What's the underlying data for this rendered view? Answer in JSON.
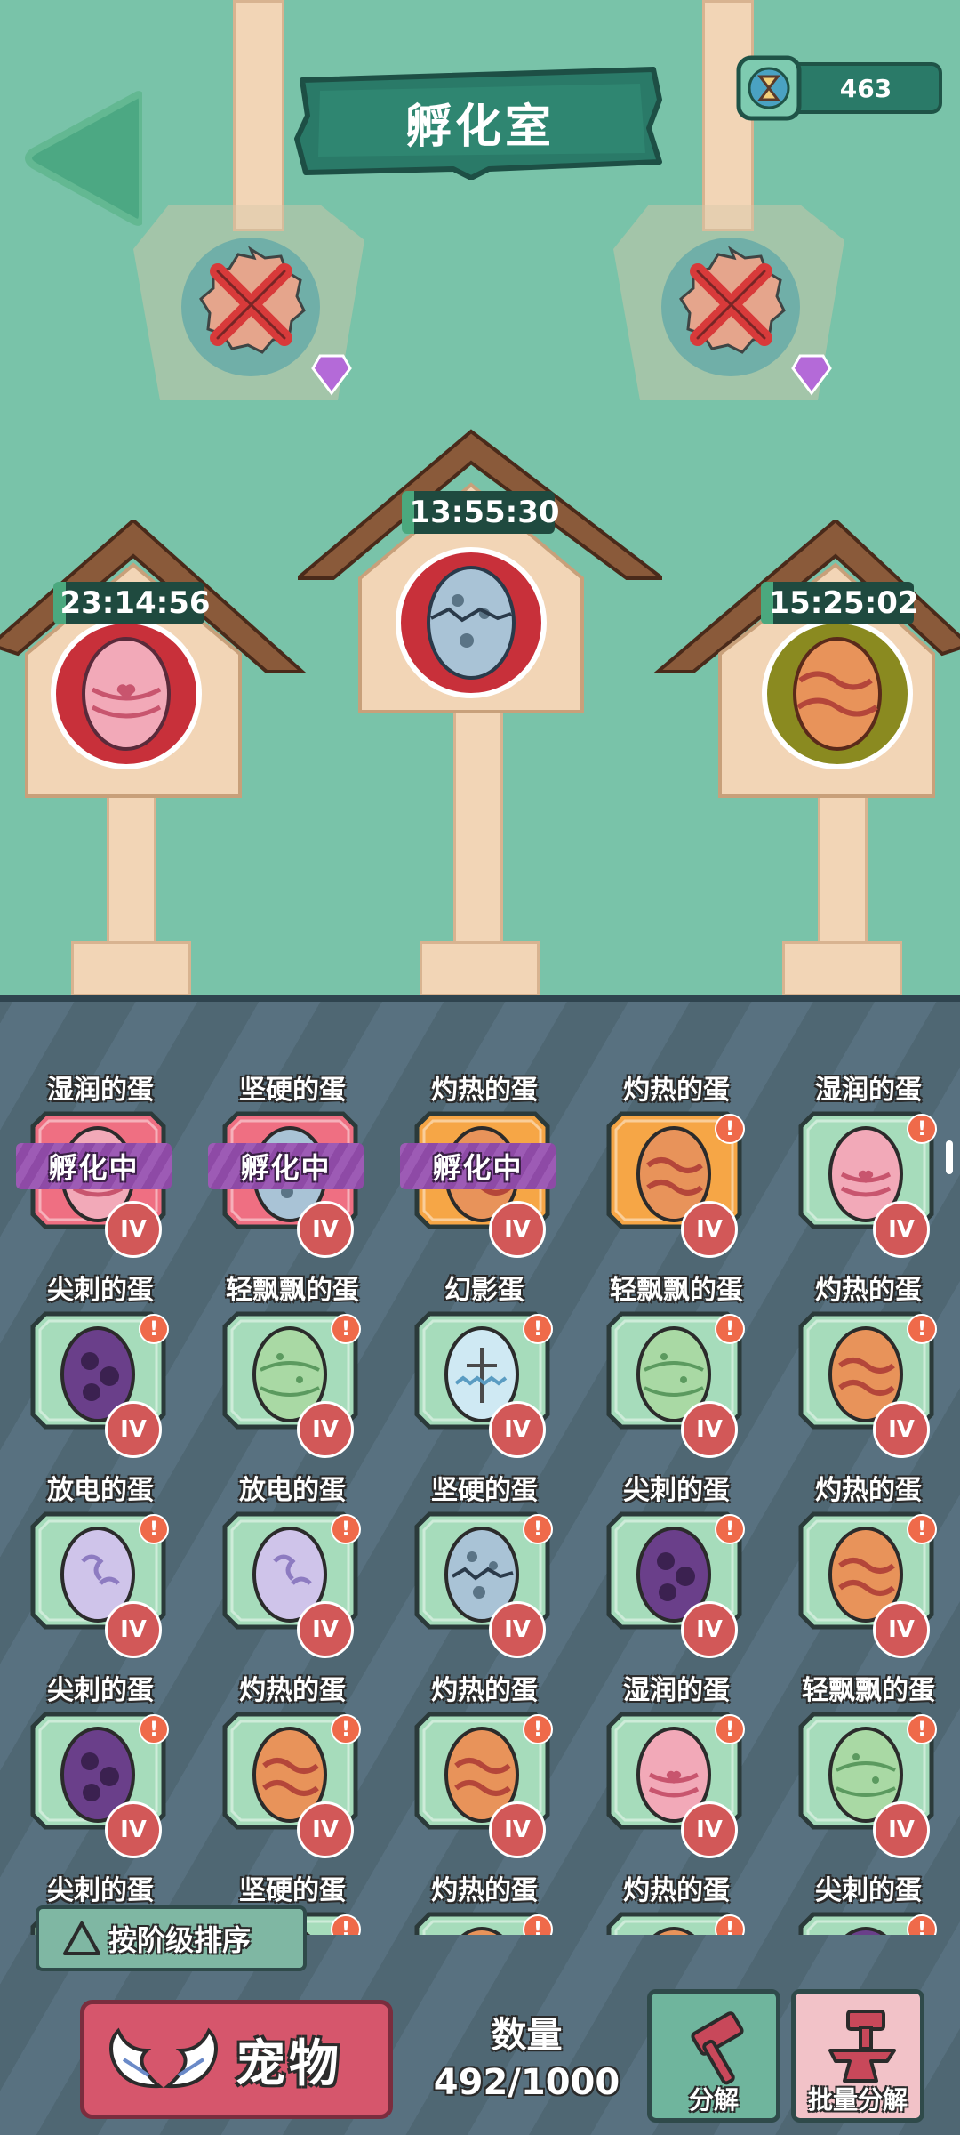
{
  "header": {
    "title": "孵化室"
  },
  "currency": {
    "value": "463",
    "icon": "hourglass-icon"
  },
  "incubators": [
    {
      "timer": "23:14:56",
      "egg": "湿润的蛋"
    },
    {
      "timer": "13:55:30",
      "egg": "坚硬的蛋"
    },
    {
      "timer": "15:25:02",
      "egg": "灼热的蛋"
    }
  ],
  "locked_slots": [
    {
      "icon": "repair-tools-icon",
      "badge": "gem-icon"
    },
    {
      "icon": "repair-tools-icon",
      "badge": "gem-icon"
    }
  ],
  "eggs": [
    {
      "name": "湿润的蛋",
      "kind": "moist",
      "status": "孵化中",
      "tier": "IV",
      "card": "red"
    },
    {
      "name": "坚硬的蛋",
      "kind": "hard",
      "status": "孵化中",
      "tier": "IV",
      "card": "red"
    },
    {
      "name": "灼热的蛋",
      "kind": "hot",
      "status": "孵化中",
      "tier": "IV",
      "card": "orange"
    },
    {
      "name": "灼热的蛋",
      "kind": "hot",
      "status": "",
      "tier": "IV",
      "card": "orange",
      "alert": "!"
    },
    {
      "name": "湿润的蛋",
      "kind": "moist",
      "status": "",
      "tier": "IV",
      "card": "green",
      "alert": "!"
    },
    {
      "name": "尖刺的蛋",
      "kind": "spike",
      "status": "",
      "tier": "IV",
      "card": "green",
      "alert": "!"
    },
    {
      "name": "轻飘飘的蛋",
      "kind": "light",
      "status": "",
      "tier": "IV",
      "card": "green",
      "alert": "!"
    },
    {
      "name": "幻影蛋",
      "kind": "phantom",
      "status": "",
      "tier": "IV",
      "card": "green",
      "alert": "!"
    },
    {
      "name": "轻飘飘的蛋",
      "kind": "light",
      "status": "",
      "tier": "IV",
      "card": "green",
      "alert": "!"
    },
    {
      "name": "灼热的蛋",
      "kind": "hot",
      "status": "",
      "tier": "IV",
      "card": "green",
      "alert": "!"
    },
    {
      "name": "放电的蛋",
      "kind": "electric",
      "status": "",
      "tier": "IV",
      "card": "green",
      "alert": "!"
    },
    {
      "name": "放电的蛋",
      "kind": "electric",
      "status": "",
      "tier": "IV",
      "card": "green",
      "alert": "!"
    },
    {
      "name": "坚硬的蛋",
      "kind": "hard",
      "status": "",
      "tier": "IV",
      "card": "green",
      "alert": "!"
    },
    {
      "name": "尖刺的蛋",
      "kind": "spike",
      "status": "",
      "tier": "IV",
      "card": "green",
      "alert": "!"
    },
    {
      "name": "灼热的蛋",
      "kind": "hot",
      "status": "",
      "tier": "IV",
      "card": "green",
      "alert": "!"
    },
    {
      "name": "尖刺的蛋",
      "kind": "spike",
      "status": "",
      "tier": "IV",
      "card": "green",
      "alert": "!"
    },
    {
      "name": "灼热的蛋",
      "kind": "hot",
      "status": "",
      "tier": "IV",
      "card": "green",
      "alert": "!"
    },
    {
      "name": "灼热的蛋",
      "kind": "hot",
      "status": "",
      "tier": "IV",
      "card": "green",
      "alert": "!"
    },
    {
      "name": "湿润的蛋",
      "kind": "moist",
      "status": "",
      "tier": "IV",
      "card": "green",
      "alert": "!"
    },
    {
      "name": "轻飘飘的蛋",
      "kind": "light",
      "status": "",
      "tier": "IV",
      "card": "green",
      "alert": "!"
    },
    {
      "name": "尖刺的蛋",
      "kind": "spike",
      "status": "",
      "tier": "IV",
      "card": "green",
      "alert": "!"
    },
    {
      "name": "坚硬的蛋",
      "kind": "hard",
      "status": "",
      "tier": "IV",
      "card": "green",
      "alert": "!"
    },
    {
      "name": "灼热的蛋",
      "kind": "hot",
      "status": "",
      "tier": "IV",
      "card": "green",
      "alert": "!"
    },
    {
      "name": "灼热的蛋",
      "kind": "hot",
      "status": "",
      "tier": "IV",
      "card": "green",
      "alert": "!"
    },
    {
      "name": "尖刺的蛋",
      "kind": "spike",
      "status": "",
      "tier": "IV",
      "card": "green",
      "alert": "!"
    }
  ],
  "egg_colors": {
    "moist": [
      "#f2a9b8",
      "#c8556e"
    ],
    "hard": [
      "#a9c3d6",
      "#5a7486"
    ],
    "hot": [
      "#e8935a",
      "#b4463a"
    ],
    "spike": [
      "#6a3f8a",
      "#3b2150"
    ],
    "light": [
      "#a9d9a4",
      "#5b9a5f"
    ],
    "phantom": [
      "#cfe9f3",
      "#5a9cc2"
    ],
    "electric": [
      "#cfc4ea",
      "#8d7bc1"
    ]
  },
  "card_colors": {
    "red": "#ef6f82",
    "orange": "#f6a646",
    "green": "#a6dcbb"
  },
  "sort_button": {
    "label": "按阶级排序"
  },
  "pet_button": {
    "label": "宠物"
  },
  "count": {
    "label": "数量",
    "value": "492/1000"
  },
  "decompose_button": {
    "label": "分解"
  },
  "batch_decompose_button": {
    "label": "批量分解"
  }
}
